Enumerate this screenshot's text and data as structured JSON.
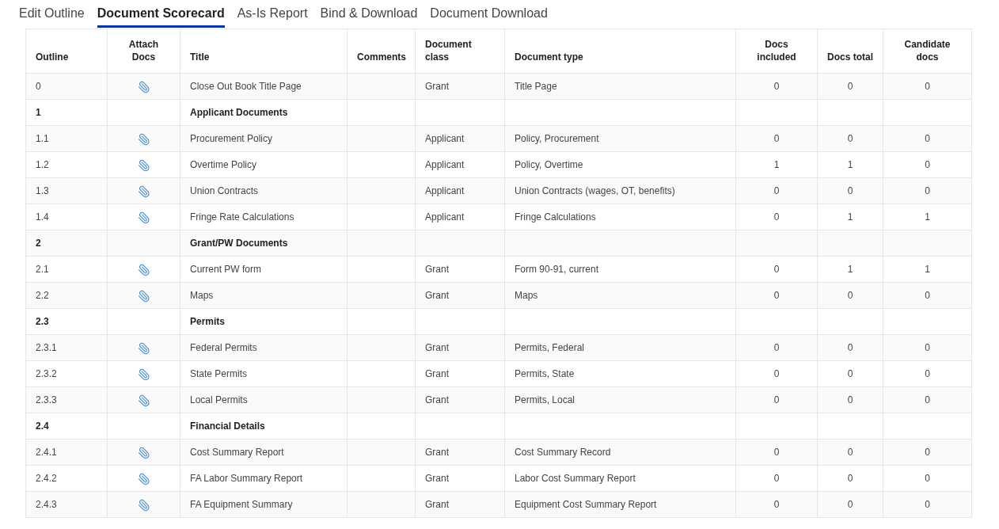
{
  "tabs": [
    {
      "label": "Edit Outline",
      "selected": false
    },
    {
      "label": "Document Scorecard",
      "selected": true
    },
    {
      "label": "As-Is Report",
      "selected": false
    },
    {
      "label": "Bind & Download",
      "selected": false
    },
    {
      "label": "Document Download",
      "selected": false
    }
  ],
  "table": {
    "columns": [
      {
        "label": "Outline",
        "kind": "text"
      },
      {
        "label": "Attach Docs",
        "kind": "icon"
      },
      {
        "label": "Title",
        "kind": "text"
      },
      {
        "label": "Comments",
        "kind": "text"
      },
      {
        "label": "Document class",
        "kind": "text"
      },
      {
        "label": "Document type",
        "kind": "text"
      },
      {
        "label": "Docs included",
        "kind": "count"
      },
      {
        "label": "Docs total",
        "kind": "count"
      },
      {
        "label": "Candidate docs",
        "kind": "count"
      }
    ],
    "rows": [
      {
        "kind": "item",
        "outline": "0",
        "title": "Close Out Book Title Page",
        "document_class": "Grant",
        "document_type": "Title Page",
        "docs_included": "0",
        "docs_total": "0",
        "candidate_docs": "0"
      },
      {
        "kind": "section",
        "outline": "1",
        "title": "Applicant Documents"
      },
      {
        "kind": "item",
        "outline": "1.1",
        "title": "Procurement Policy",
        "document_class": "Applicant",
        "document_type": "Policy, Procurement",
        "docs_included": "0",
        "docs_total": "0",
        "candidate_docs": "0"
      },
      {
        "kind": "item",
        "outline": "1.2",
        "title": "Overtime Policy",
        "document_class": "Applicant",
        "document_type": "Policy, Overtime",
        "docs_included": "1",
        "docs_total": "1",
        "candidate_docs": "0"
      },
      {
        "kind": "item",
        "outline": "1.3",
        "title": "Union Contracts",
        "document_class": "Applicant",
        "document_type": "Union Contracts (wages, OT, benefits)",
        "docs_included": "0",
        "docs_total": "0",
        "candidate_docs": "0"
      },
      {
        "kind": "item",
        "outline": "1.4",
        "title": "Fringe Rate Calculations",
        "document_class": "Applicant",
        "document_type": "Fringe Calculations",
        "docs_included": "0",
        "docs_total": "1",
        "candidate_docs": "1"
      },
      {
        "kind": "section",
        "outline": "2",
        "title": "Grant/PW Documents"
      },
      {
        "kind": "item",
        "outline": "2.1",
        "title": "Current PW form",
        "document_class": "Grant",
        "document_type": "Form 90-91, current",
        "docs_included": "0",
        "docs_total": "1",
        "candidate_docs": "1"
      },
      {
        "kind": "item",
        "outline": "2.2",
        "title": "Maps",
        "document_class": "Grant",
        "document_type": "Maps",
        "docs_included": "0",
        "docs_total": "0",
        "candidate_docs": "0"
      },
      {
        "kind": "section",
        "outline": "2.3",
        "title": "Permits"
      },
      {
        "kind": "item",
        "outline": "2.3.1",
        "title": "Federal Permits",
        "document_class": "Grant",
        "document_type": "Permits, Federal",
        "docs_included": "0",
        "docs_total": "0",
        "candidate_docs": "0"
      },
      {
        "kind": "item",
        "outline": "2.3.2",
        "title": "State Permits",
        "document_class": "Grant",
        "document_type": "Permits, State",
        "docs_included": "0",
        "docs_total": "0",
        "candidate_docs": "0"
      },
      {
        "kind": "item",
        "outline": "2.3.3",
        "title": "Local Permits",
        "document_class": "Grant",
        "document_type": "Permits, Local",
        "docs_included": "0",
        "docs_total": "0",
        "candidate_docs": "0"
      },
      {
        "kind": "section",
        "outline": "2.4",
        "title": "Financial Details"
      },
      {
        "kind": "item",
        "outline": "2.4.1",
        "title": "Cost Summary Report",
        "document_class": "Grant",
        "document_type": "Cost Summary Record",
        "docs_included": "0",
        "docs_total": "0",
        "candidate_docs": "0"
      },
      {
        "kind": "item",
        "outline": "2.4.2",
        "title": "FA Labor Summary Report",
        "document_class": "Grant",
        "document_type": "Labor Cost Summary Report",
        "docs_included": "0",
        "docs_total": "0",
        "candidate_docs": "0"
      },
      {
        "kind": "item",
        "outline": "2.4.3",
        "title": "FA Equipment Summary",
        "document_class": "Grant",
        "document_type": "Equipment Cost Summary Report",
        "docs_included": "0",
        "docs_total": "0",
        "candidate_docs": "0"
      }
    ]
  }
}
